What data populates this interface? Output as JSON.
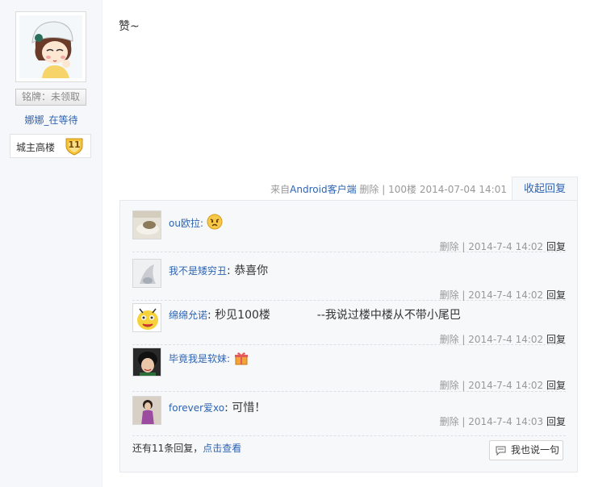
{
  "sidebar": {
    "badge_label": "铭牌：未领取",
    "username": "娜娜_在等待",
    "level_title": "城主高楼",
    "level_number": "11"
  },
  "post": {
    "content": "赞~",
    "source_prefix": "来自",
    "source_link": "Android客户端",
    "delete_label": "删除",
    "sep": "|",
    "floor": "100楼",
    "datetime": "2014-07-04 14:01",
    "collapse_label": "收起回复"
  },
  "replies": [
    {
      "name": "ou欧拉",
      "colon": ":",
      "text": "",
      "emoji": "angry-emoji",
      "delete": "删除",
      "sep": "|",
      "time": "2014-7-4 14:02",
      "reply": "回复"
    },
    {
      "name": "我不是矮穷丑",
      "colon": ":",
      "text": "恭喜你",
      "delete": "删除",
      "sep": "|",
      "time": "2014-7-4 14:02",
      "reply": "回复"
    },
    {
      "name": "绵绵允诺",
      "colon": ":",
      "text": "秒见100楼             --我说过楼中楼从不带小尾巴",
      "delete": "删除",
      "sep": "|",
      "time": "2014-7-4 14:02",
      "reply": "回复"
    },
    {
      "name": "毕竟我是软妹",
      "colon": ":",
      "text": "",
      "emoji": "gift-emoji",
      "delete": "删除",
      "sep": "|",
      "time": "2014-7-4 14:02",
      "reply": "回复"
    },
    {
      "name": "forever爱xo",
      "colon": ":",
      "text": "可惜！",
      "delete": "删除",
      "sep": "|",
      "time": "2014-7-4 14:03",
      "reply": "回复"
    }
  ],
  "footer": {
    "more_prefix": "还有11条回复，",
    "more_link": "点击查看",
    "say_label": "我也说一句"
  },
  "colors": {
    "link": "#2d64b3",
    "meta": "#999999",
    "panel_bg": "#f7f8fa"
  }
}
